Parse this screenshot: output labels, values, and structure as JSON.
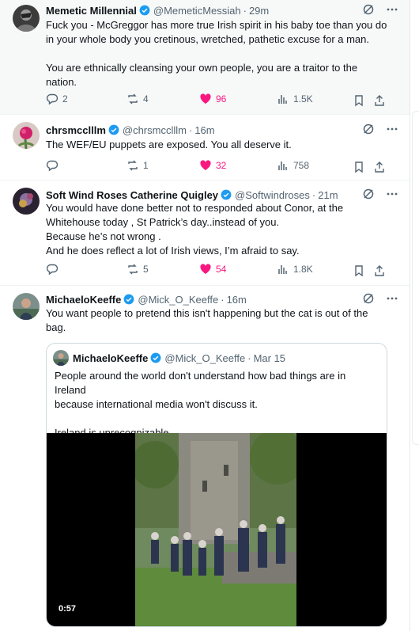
{
  "tweets": [
    {
      "name": "Memetic Millennial",
      "handle": "@MemeticMessiah",
      "time": "29m",
      "text_lines": [
        "Fuck you - McGreggor has more true Irish spirit in his baby toe than you do",
        "in your whole body you cretinous, wretched, pathetic excuse for a man.",
        "",
        "You are ethnically cleansing your own people, you are a traitor to the",
        "nation."
      ],
      "replies": "2",
      "reposts": "4",
      "likes": "96",
      "views": "1.5K"
    },
    {
      "name": "chrsmcclllm",
      "handle": "@chrsmcclllm",
      "time": "16m",
      "text_lines": [
        "The WEF/EU puppets are exposed. You all deserve it."
      ],
      "replies": "",
      "reposts": "1",
      "likes": "32",
      "views": "758"
    },
    {
      "name": "Soft Wind Roses Catherine Quigley",
      "handle": "@Softwindroses",
      "time": "21m",
      "text_lines": [
        "You would have done better not to responded about Conor, at the",
        "Whitehouse today , St Patrick’s day..instead of you.",
        "Because he’s not wrong .",
        "And he does reflect a lot of Irish views, I’m afraid to say."
      ],
      "replies": "",
      "reposts": "5",
      "likes": "54",
      "views": "1.8K"
    },
    {
      "name": "MichaeloKeeffe",
      "handle": "@Mick_O_Keeffe",
      "time": "16m",
      "text_lines": [
        "You want people to pretend this isn't happening but the cat is out of the",
        "bag."
      ]
    }
  ],
  "quote": {
    "name": "MichaeloKeeffe",
    "handle": "@Mick_O_Keeffe",
    "time": "Mar 15",
    "text_lines": [
      "People around the world don't understand how bad things are in Ireland",
      "because international media won't discuss it.",
      "",
      "Ireland is unrecognizable."
    ],
    "video_duration": "0:57"
  },
  "separator": "·",
  "colors": {
    "verified": "#1d9bf0",
    "like": "#f91880",
    "muted": "#536471",
    "text": "#0f1419"
  },
  "icons": [
    "reply-icon",
    "repost-icon",
    "like-icon",
    "views-icon",
    "bookmark-icon",
    "share-icon",
    "grok-icon",
    "more-icon",
    "verified-badge-icon"
  ]
}
